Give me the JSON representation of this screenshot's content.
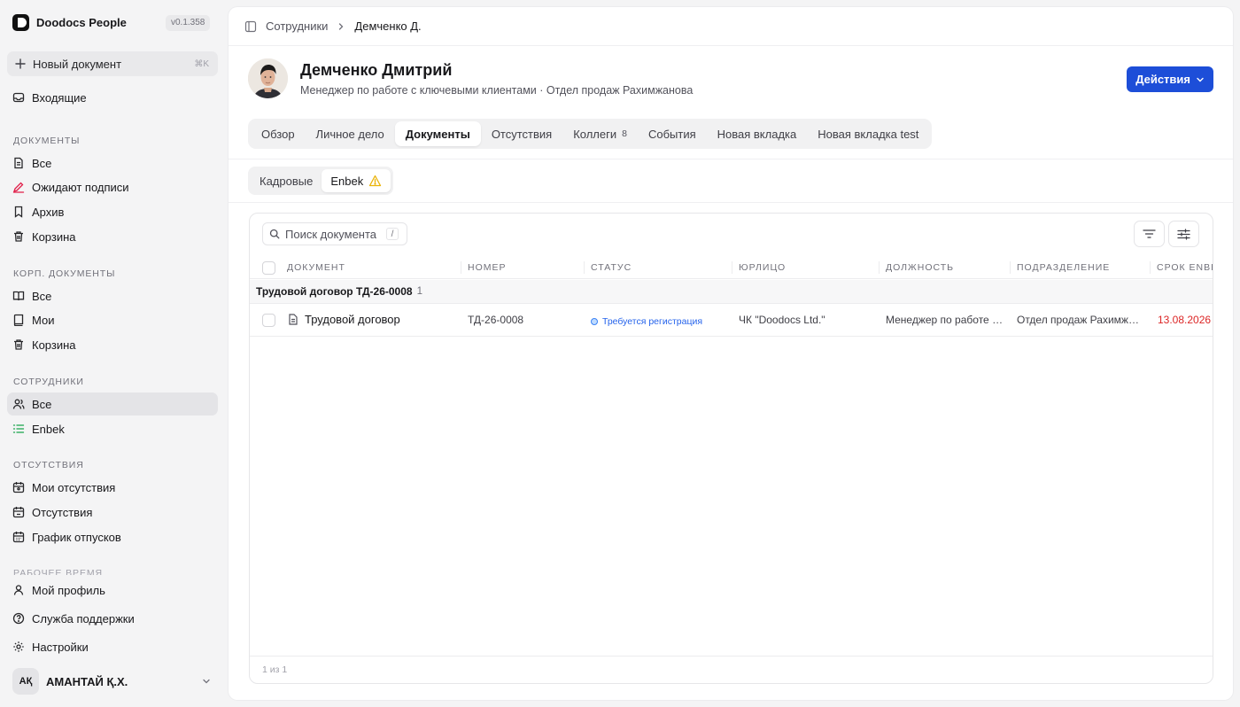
{
  "app": {
    "name": "Doodocs People",
    "version": "v0.1.358"
  },
  "sidebar": {
    "new_doc": {
      "label": "Новый документ",
      "shortcut": "⌘K"
    },
    "inbox": "Входящие",
    "sections": {
      "documents": {
        "title": "ДОКУМЕНТЫ",
        "items": [
          "Все",
          "Ожидают подписи",
          "Архив",
          "Корзина"
        ]
      },
      "corp_documents": {
        "title": "КОРП. ДОКУМЕНТЫ",
        "items": [
          "Все",
          "Мои",
          "Корзина"
        ]
      },
      "employees": {
        "title": "СОТРУДНИКИ",
        "items": [
          "Все",
          "Enbek"
        ],
        "active": "Все"
      },
      "absences": {
        "title": "ОТСУТСТВИЯ",
        "items": [
          "Мои отсутствия",
          "Отсутствия",
          "График отпусков"
        ]
      },
      "work_time": {
        "title": "РАБОЧЕЕ ВРЕМЯ"
      }
    },
    "bottom": {
      "profile": "Мой профиль",
      "support": "Служба поддержки",
      "settings": "Настройки"
    },
    "user": {
      "initials": "AҚ",
      "name": "АМАНТАЙ Қ.Х."
    }
  },
  "breadcrumb": {
    "parent": "Сотрудники",
    "current": "Демченко Д."
  },
  "employee": {
    "name": "Демченко Дмитрий",
    "subtitle": "Менеджер по работе с ключевыми клиентами · Отдел продаж Рахимжанова"
  },
  "actions_label": "Действия",
  "tabs": [
    {
      "label": "Обзор"
    },
    {
      "label": "Личное дело"
    },
    {
      "label": "Документы",
      "active": true
    },
    {
      "label": "Отсутствия"
    },
    {
      "label": "Коллеги",
      "count": "8"
    },
    {
      "label": "События"
    },
    {
      "label": "Новая вкладка"
    },
    {
      "label": "Новая вкладка test"
    }
  ],
  "subtabs": [
    {
      "label": "Кадровые"
    },
    {
      "label": "Enbek",
      "active": true,
      "warning": true
    }
  ],
  "search": {
    "placeholder": "Поиск документа",
    "shortcut": "/"
  },
  "table": {
    "columns": [
      "ДОКУМЕНТ",
      "НОМЕР",
      "СТАТУС",
      "ЮРЛИЦО",
      "ДОЛЖНОСТЬ",
      "ПОДРАЗДЕЛЕНИЕ",
      "СРОК ENBEK"
    ],
    "group": {
      "label": "Трудовой договор ТД-26-0008",
      "count": "1"
    },
    "rows": [
      {
        "document": "Трудовой договор",
        "number": "ТД-26-0008",
        "status": "Требуется регистрация",
        "entity": "ЧК \"Doodocs Ltd.\"",
        "position": "Менеджер по работе с ключевыми клиентами",
        "department": "Отдел продаж Рахимжанова",
        "deadline": "13.08.2026"
      }
    ],
    "pager": "1 из 1"
  },
  "colors": {
    "accent": "#1d4ed8",
    "status_blue": "#2563eb",
    "deadline_red": "#dc2626",
    "warning": "#eab308"
  }
}
